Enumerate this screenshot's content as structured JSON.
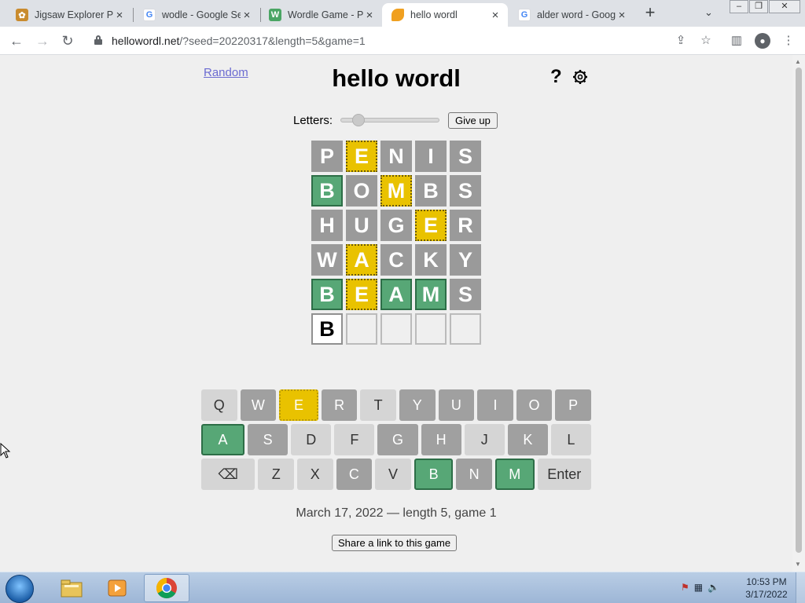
{
  "browser": {
    "tabs": [
      {
        "title": "Jigsaw Explorer Pu",
        "active": false
      },
      {
        "title": "wodle - Google Se",
        "active": false
      },
      {
        "title": "Wordle Game - Pla",
        "active": false
      },
      {
        "title": "hello wordl",
        "active": true
      },
      {
        "title": "alder word - Goog",
        "active": false
      }
    ],
    "url_host": "hellowordl.net",
    "url_path": "/?seed=20220317&length=5&game=1"
  },
  "page": {
    "random_label": "Random",
    "title": "hello wordl",
    "help_label": "?",
    "letters_label": "Letters:",
    "slider_level": 5,
    "give_up_label": "Give up",
    "board": [
      [
        {
          "l": "P",
          "s": "absent"
        },
        {
          "l": "E",
          "s": "present"
        },
        {
          "l": "N",
          "s": "absent"
        },
        {
          "l": "I",
          "s": "absent"
        },
        {
          "l": "S",
          "s": "absent"
        }
      ],
      [
        {
          "l": "B",
          "s": "correct"
        },
        {
          "l": "O",
          "s": "absent"
        },
        {
          "l": "M",
          "s": "present"
        },
        {
          "l": "B",
          "s": "absent"
        },
        {
          "l": "S",
          "s": "absent"
        }
      ],
      [
        {
          "l": "H",
          "s": "absent"
        },
        {
          "l": "U",
          "s": "absent"
        },
        {
          "l": "G",
          "s": "absent"
        },
        {
          "l": "E",
          "s": "present"
        },
        {
          "l": "R",
          "s": "absent"
        }
      ],
      [
        {
          "l": "W",
          "s": "absent"
        },
        {
          "l": "A",
          "s": "present"
        },
        {
          "l": "C",
          "s": "absent"
        },
        {
          "l": "K",
          "s": "absent"
        },
        {
          "l": "Y",
          "s": "absent"
        }
      ],
      [
        {
          "l": "B",
          "s": "correct"
        },
        {
          "l": "E",
          "s": "present"
        },
        {
          "l": "A",
          "s": "correct"
        },
        {
          "l": "M",
          "s": "correct"
        },
        {
          "l": "S",
          "s": "absent"
        }
      ],
      [
        {
          "l": "B",
          "s": "pending"
        },
        {
          "l": "",
          "s": "empty"
        },
        {
          "l": "",
          "s": "empty"
        },
        {
          "l": "",
          "s": "empty"
        },
        {
          "l": "",
          "s": "empty"
        }
      ]
    ],
    "keyboard": [
      [
        {
          "k": "Q",
          "s": "unused"
        },
        {
          "k": "W",
          "s": "absent"
        },
        {
          "k": "E",
          "s": "present"
        },
        {
          "k": "R",
          "s": "absent"
        },
        {
          "k": "T",
          "s": "unused"
        },
        {
          "k": "Y",
          "s": "absent"
        },
        {
          "k": "U",
          "s": "absent"
        },
        {
          "k": "I",
          "s": "absent"
        },
        {
          "k": "O",
          "s": "absent"
        },
        {
          "k": "P",
          "s": "absent"
        }
      ],
      [
        {
          "k": "A",
          "s": "correct"
        },
        {
          "k": "S",
          "s": "absent"
        },
        {
          "k": "D",
          "s": "unused"
        },
        {
          "k": "F",
          "s": "unused"
        },
        {
          "k": "G",
          "s": "absent"
        },
        {
          "k": "H",
          "s": "absent"
        },
        {
          "k": "J",
          "s": "unused"
        },
        {
          "k": "K",
          "s": "absent"
        },
        {
          "k": "L",
          "s": "unused"
        }
      ],
      [
        {
          "k": "⌫",
          "s": "unused",
          "wide": true
        },
        {
          "k": "Z",
          "s": "unused"
        },
        {
          "k": "X",
          "s": "unused"
        },
        {
          "k": "C",
          "s": "absent"
        },
        {
          "k": "V",
          "s": "unused"
        },
        {
          "k": "B",
          "s": "correct"
        },
        {
          "k": "N",
          "s": "absent"
        },
        {
          "k": "M",
          "s": "correct"
        },
        {
          "k": "Enter",
          "s": "unused",
          "wide": true
        }
      ]
    ],
    "date_line": "March 17, 2022 — length 5, game 1",
    "share_label": "Share a link to this game"
  },
  "taskbar": {
    "time": "10:53 PM",
    "date": "3/17/2022"
  },
  "colors": {
    "correct": "#57a776",
    "present": "#e9c200",
    "absent": "#9a9a9a"
  }
}
